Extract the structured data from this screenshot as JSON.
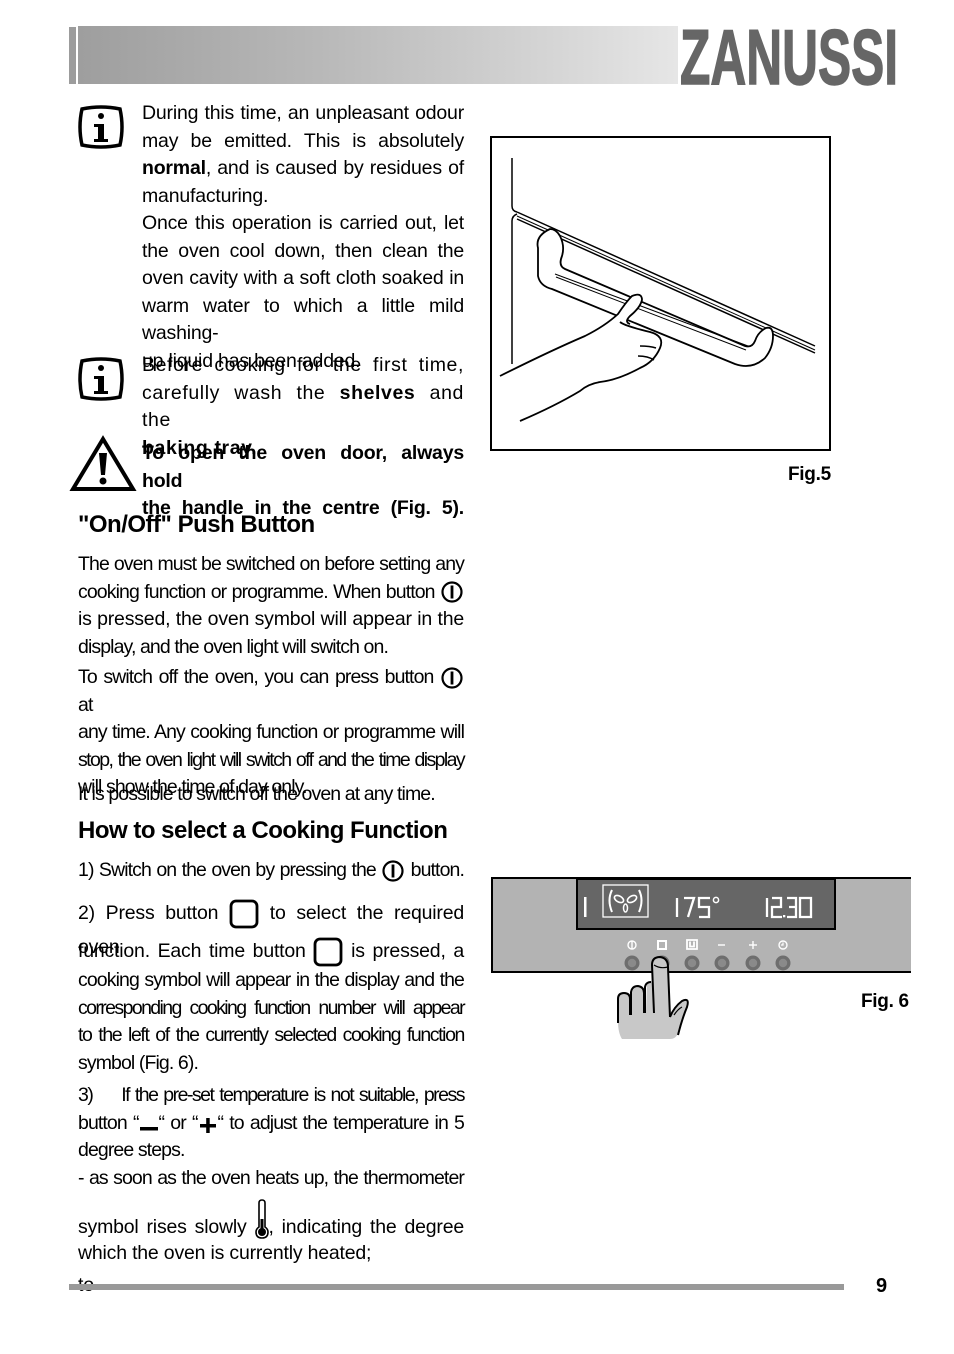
{
  "header": {
    "brand": "ZANUSSI"
  },
  "notes": [
    {
      "icon": "info-icon",
      "lines": [
        [
          "During this time, an unpleasant odour"
        ],
        [
          "may be emitted. This is absolutely"
        ],
        [
          {
            "b": "normal"
          },
          ", and is caused by residues of"
        ],
        [
          "manufacturing."
        ],
        [
          "Once this operation is carried out, let"
        ],
        [
          "the oven cool down, then clean the"
        ],
        [
          "oven cavity with a soft cloth soaked in"
        ],
        [
          "warm water to which a little mild washing-"
        ],
        [
          "up liquid has been added."
        ]
      ]
    },
    {
      "icon": "info-icon",
      "lines": [
        [
          "Before cooking for the first time,"
        ],
        [
          "carefully wash the ",
          {
            "b": "shelves"
          },
          " and the"
        ],
        [
          {
            "b": "baking tray."
          }
        ]
      ]
    },
    {
      "icon": "warning-icon",
      "lines": [
        [
          {
            "b": "To open the oven door, always hold"
          }
        ],
        [
          {
            "b": "the handle in the centre (Fig. 5)."
          }
        ]
      ]
    }
  ],
  "section_onoff": {
    "title": "\"On/Off\" Push Button",
    "p1_lines": [
      "The oven must be switched on before setting any",
      "cooking function or programme. When button",
      "is pressed, the oven symbol will appear in the",
      "display, and the oven light will switch on."
    ],
    "p2_lines": [
      "To switch off the oven, you can press button",
      "at",
      "any time. Any cooking function or programme will",
      "stop, the oven light will switch off and the time display",
      "will show the time of day only."
    ],
    "p3": "It is possible to switch off the oven at any time."
  },
  "section_cooking": {
    "title": "How to select a Cooking Function",
    "step1_a": "1) Switch on the oven by pressing the",
    "step1_b": "button.",
    "step2_a": "2) Press button",
    "step2_b": "to select the required oven",
    "step2_c": "function. Each time button",
    "step2_d": "is pressed, a",
    "step2_lines": [
      "cooking symbol will  appear in the display and the",
      "corresponding cooking function number will  appear",
      "to the left of the currently selected cooking function",
      "symbol (Fig. 6)."
    ],
    "step3_lines": [
      "3)     If the pre-set temperature is not suitable, press"
    ],
    "step3_b": "button “",
    "step3_c": "“ or “",
    "step3_d": "“ to adjust the temperature in 5",
    "step3_e": "degree steps.",
    "step3_f": "- as soon as the oven heats up, the thermometer",
    "step3_g": "symbol rises slowly",
    "step3_h": ", indicating the degree to",
    "step3_i": "which the oven is currently heated;"
  },
  "fig5": {
    "label": "Fig.5"
  },
  "fig6": {
    "label": "Fig. 6",
    "display": {
      "function_number": "1",
      "function_symbol": "fan-function-icon",
      "temperature": "175°",
      "time": "12.30"
    },
    "buttons": [
      {
        "symbol": "power-icon",
        "glyph": "Ⓘ"
      },
      {
        "symbol": "function-select-icon",
        "glyph": "□"
      },
      {
        "symbol": "programme-icon",
        "glyph": "U"
      },
      {
        "symbol": "minus-icon",
        "glyph": "−"
      },
      {
        "symbol": "plus-icon",
        "glyph": "+"
      },
      {
        "symbol": "clock-icon",
        "glyph": "◷"
      }
    ],
    "pressed_button": "function-select-icon"
  },
  "footer": {
    "page_number": "9"
  }
}
